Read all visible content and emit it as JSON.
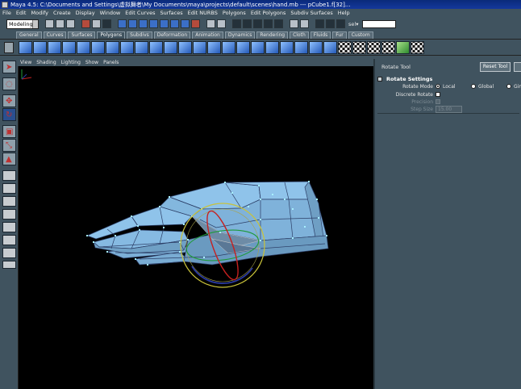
{
  "window": {
    "title": "Maya 4.5: C:\\Documents and Settings\\虚拟舞者\\My Documents\\maya\\projects\\default\\scenes\\hand.mb  ---  pCube1.f[32]..."
  },
  "menubar": {
    "items": [
      "File",
      "Edit",
      "Modify",
      "Create",
      "Display",
      "Window",
      "Edit Curves",
      "Surfaces",
      "Edit NURBS",
      "Polygons",
      "Edit Polygons",
      "Subdiv Surfaces",
      "Help"
    ]
  },
  "statusline": {
    "mode": "Modeling",
    "sel_label": "sel▾",
    "sel_value": ""
  },
  "shelf": {
    "tabs": [
      "General",
      "Curves",
      "Surfaces",
      "Polygons",
      "Subdivs",
      "Deformation",
      "Animation",
      "Dynamics",
      "Rendering",
      "Cloth",
      "Fluids",
      "Fur",
      "Custom"
    ],
    "active_tab": "Polygons"
  },
  "viewport": {
    "menu": [
      "View",
      "Shading",
      "Lighting",
      "Show",
      "Panels"
    ],
    "colors": {
      "mesh": "#8fc3ea",
      "wire": "#2c3e66",
      "vertex": "#a8f0ff",
      "manip_outer": "#c9c23a",
      "manip_red": "#c62020",
      "manip_blue": "#2a3aa0",
      "manip_green": "#1f9a3a"
    }
  },
  "tool_settings": {
    "tool_name": "Rotate Tool",
    "reset_label": "Reset Tool",
    "section": "Rotate Settings",
    "rotate_mode_label": "Rotate Mode",
    "modes": [
      "Local",
      "Global",
      "Gimbal"
    ],
    "selected_mode": "Local",
    "discrete_label": "Discrete Rotate",
    "precision_label": "Precision",
    "step_label": "Step Size",
    "step_value": "15.00"
  }
}
